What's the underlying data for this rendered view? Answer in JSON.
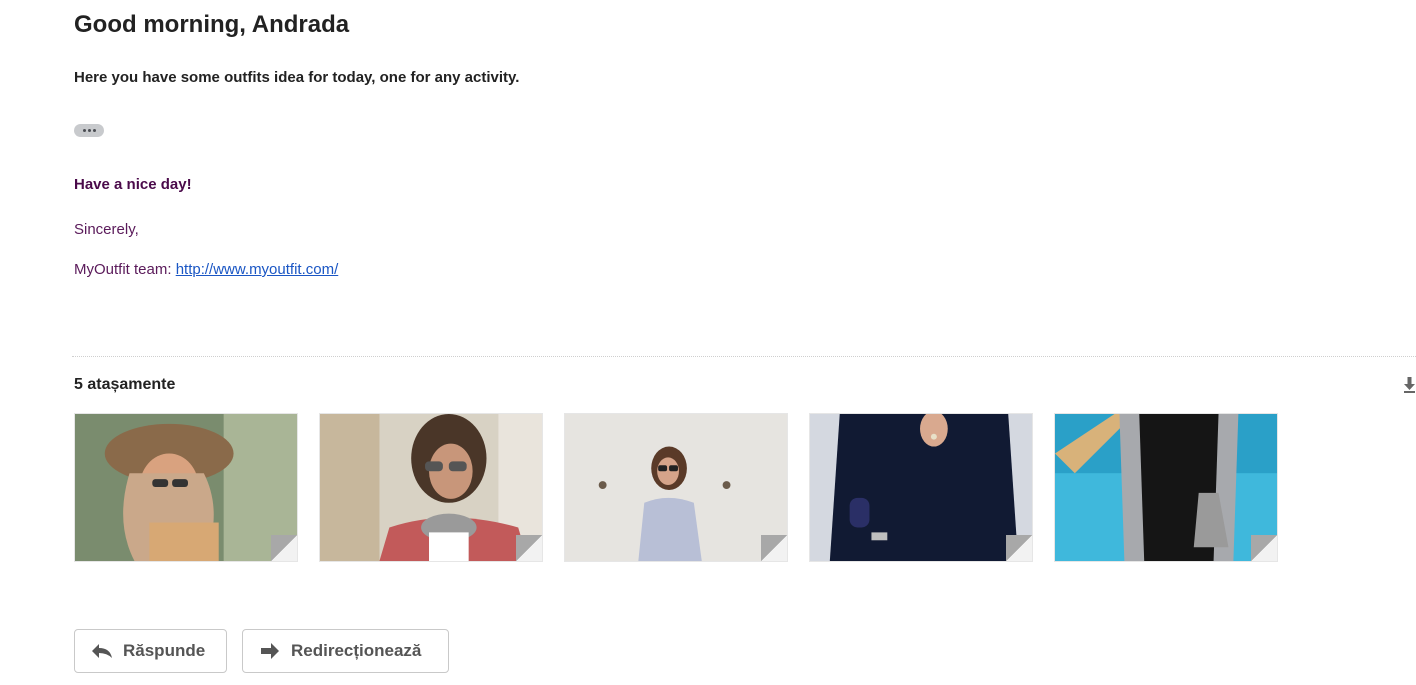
{
  "email": {
    "greeting": "Good morning, Andrada",
    "intro": "Here you have some outfits idea for today, one for any activity.",
    "nice_day": "Have a nice day!",
    "sincerely": "Sincerely,",
    "team_label": "MyOutfit team: ",
    "team_link": "http://www.myoutfit.com/"
  },
  "attachments": {
    "count_label": "5 atașamente",
    "items": [
      {
        "icon": "image-thumbnail"
      },
      {
        "icon": "image-thumbnail"
      },
      {
        "icon": "image-thumbnail"
      },
      {
        "icon": "image-thumbnail"
      },
      {
        "icon": "image-thumbnail"
      }
    ]
  },
  "actions": {
    "reply_label": "Răspunde",
    "forward_label": "Redirecționează"
  },
  "colors": {
    "link": "#1a56c4",
    "signature": "#5a1a5a"
  }
}
